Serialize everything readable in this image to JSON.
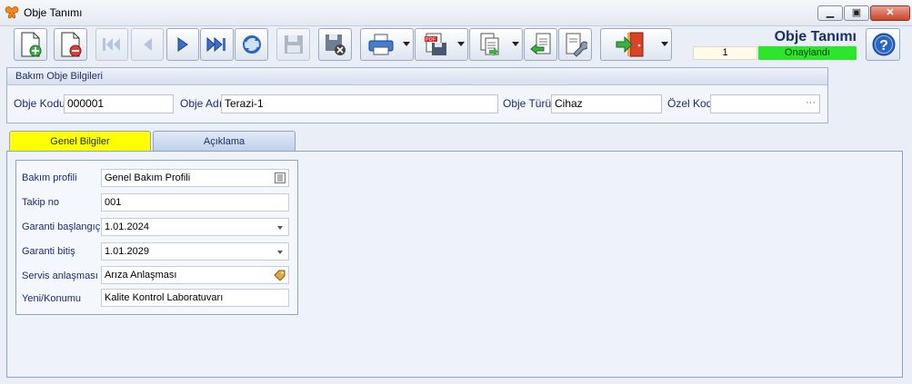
{
  "window": {
    "title": "Obje Tanımı",
    "controls": [
      "minimize",
      "maximize",
      "close"
    ]
  },
  "toolbar": {
    "buttons": [
      {
        "icon": "new-document-icon"
      },
      {
        "icon": "delete-document-icon"
      },
      {
        "icon": "first-record-icon"
      },
      {
        "icon": "previous-record-icon"
      },
      {
        "icon": "next-record-icon"
      },
      {
        "icon": "last-record-icon"
      },
      {
        "icon": "refresh-icon"
      },
      {
        "icon": "save-icon"
      },
      {
        "icon": "cancel-save-icon"
      },
      {
        "icon": "print-icon"
      },
      {
        "icon": "pdf-export-icon"
      },
      {
        "icon": "copy-document-icon"
      },
      {
        "icon": "import-icon"
      },
      {
        "icon": "tools-icon"
      },
      {
        "icon": "exit-icon"
      }
    ]
  },
  "header": {
    "title": "Obje Tanımı",
    "record_number": "1",
    "status": "Onaylandı",
    "status_color": "#2de52d",
    "help_icon": "help-icon"
  },
  "object_info": {
    "group_title": "Bakım Obje Bilgileri",
    "code_label": "Obje Kodu",
    "code_value": "000001",
    "name_label": "Obje Adı",
    "name_value": "Terazi-1",
    "type_label": "Obje Türü",
    "type_value": "Cihaz",
    "special_code_label": "Özel Kod",
    "special_code_value": ""
  },
  "tabs": [
    {
      "label": "Genel Bilgiler",
      "active": true,
      "color": "#ffff00"
    },
    {
      "label": "Açıklama",
      "active": false
    }
  ],
  "general": {
    "profile_label": "Bakım profili",
    "profile_value": "Genel Bakım Profili",
    "tracking_label": "Takip no",
    "tracking_value": "001",
    "warranty_start_label": "Garanti başlangıç",
    "warranty_start_value": "1.01.2024",
    "warranty_end_label": "Garanti bitiş",
    "warranty_end_value": "1.01.2029",
    "service_label": "Servis anlaşması",
    "service_value": "Arıza Anlaşması",
    "location_label": "Yeni/Konumu",
    "location_value": "Kalite Kontrol Laboratuvarı"
  }
}
